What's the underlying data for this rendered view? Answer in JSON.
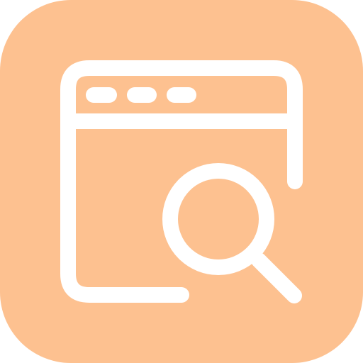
{
  "icon": {
    "name": "browser-search-icon",
    "background_color": "#FDC190",
    "stroke_color": "#FFFFFF"
  }
}
